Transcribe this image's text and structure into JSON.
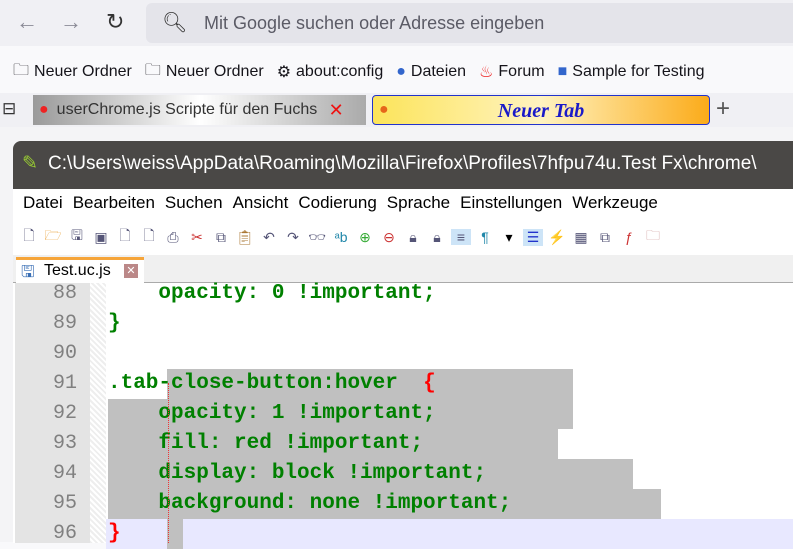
{
  "nav": {
    "back": "←",
    "forward": "→",
    "reload": "↻",
    "search_icon": "search-icon",
    "url_placeholder": "Mit Google suchen oder Adresse eingeben"
  },
  "bookmarks": [
    {
      "icon": "folder-icon",
      "label": "Neuer Ordner"
    },
    {
      "icon": "folder-icon",
      "label": "Neuer Ordner"
    },
    {
      "icon": "gear-icon",
      "label": "about:config"
    },
    {
      "icon": "globe-icon",
      "label": "Dateien"
    },
    {
      "icon": "flame-icon",
      "label": "Forum"
    },
    {
      "icon": "book-icon",
      "label": "Sample for Testing"
    }
  ],
  "tabs": [
    {
      "label": "userChrome.js Scripte für den Fuchs",
      "close": "✕"
    },
    {
      "label": "Neuer Tab"
    }
  ],
  "new_tab": "+",
  "notepad": {
    "title": "C:\\Users\\weiss\\AppData\\Roaming\\Mozilla\\Firefox\\Profiles\\7hfpu74u.Test Fx\\chrome\\",
    "menu": [
      "Datei",
      "Bearbeiten",
      "Suchen",
      "Ansicht",
      "Codierung",
      "Sprache",
      "Einstellungen",
      "Werkzeuge"
    ],
    "doc_tab": "Test.uc.js",
    "doc_close": "✕",
    "lines": [
      {
        "n": "88",
        "code": "    opacity: 0 !important;"
      },
      {
        "n": "89",
        "code": "}"
      },
      {
        "n": "90",
        "code": ""
      },
      {
        "n": "91",
        "code": ".tab-close-button:hover  {"
      },
      {
        "n": "92",
        "code": "    opacity: 1 !important;"
      },
      {
        "n": "93",
        "code": "    fill: red !important;"
      },
      {
        "n": "94",
        "code": "    display: block !important;"
      },
      {
        "n": "95",
        "code": "    background: none !important;"
      },
      {
        "n": "96",
        "code": "}"
      }
    ]
  },
  "colors": {
    "code": "#008000",
    "brace_red": "#ff0000",
    "selection": "#c0c0c0",
    "tab_text": "#1a1ac8"
  }
}
